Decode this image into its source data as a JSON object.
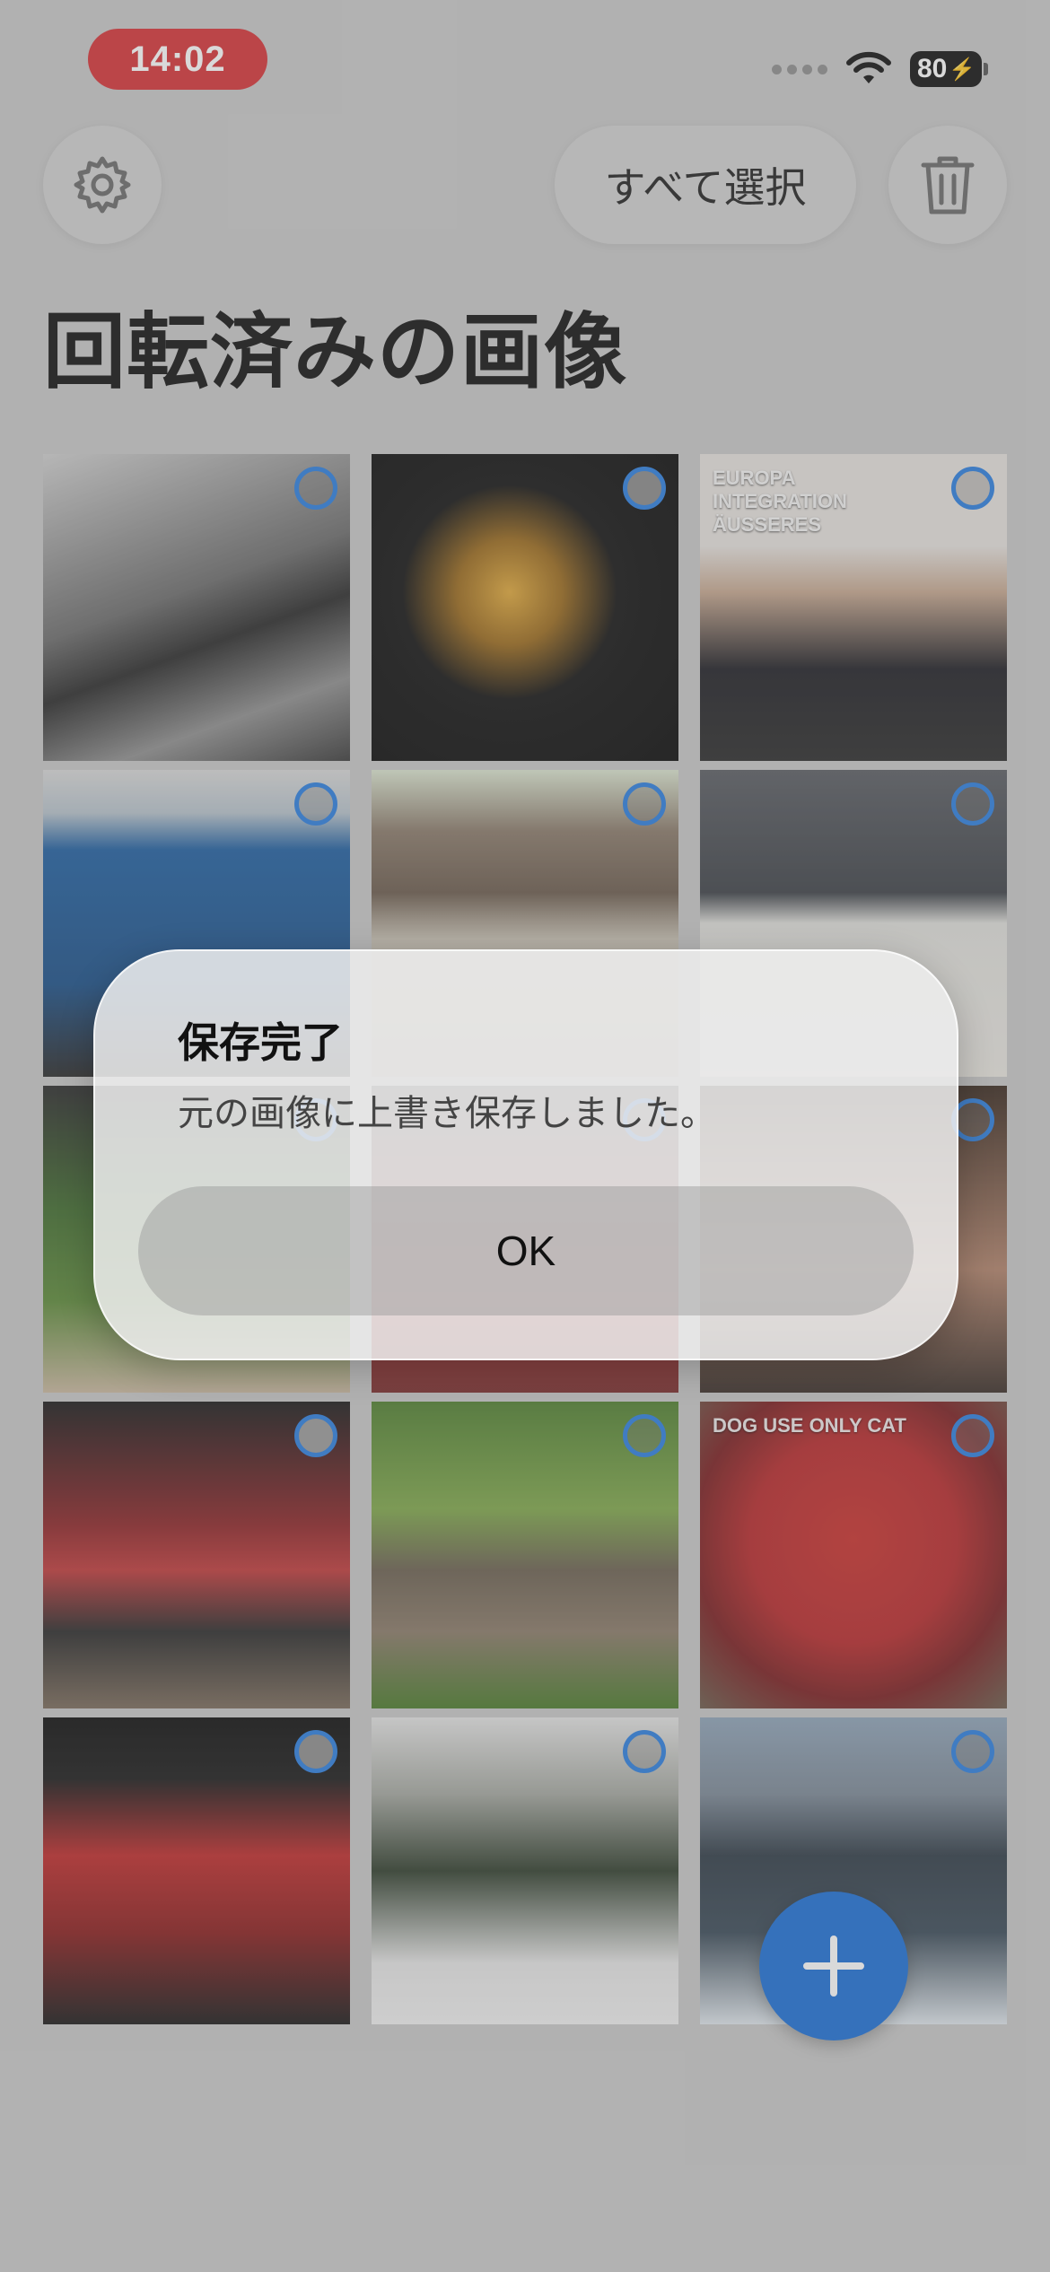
{
  "status_bar": {
    "time": "14:02",
    "battery": "80"
  },
  "toolbar": {
    "select_all_label": "すべて選択"
  },
  "page": {
    "title": "回転済みの画像"
  },
  "photos": [
    {
      "label": "",
      "bg": "linear-gradient(160deg,#cfcfcf 0%,#6c6c6c 45%,#2a2a2a 60%,#8f8f8f 80%,#3b3b3b 100%)",
      "check_fill": ""
    },
    {
      "label": "",
      "bg": "radial-gradient(ellipse at 45% 45%,#e0a83a 0%,#9b6a1c 22%,#121212 45%,#0a0a0a 100%)",
      "check_fill": "#8a8a8a"
    },
    {
      "label": "EUROPA INTEGRATION ÄUSSERES",
      "bg": "linear-gradient(180deg,#e6e2de 0%,#e6e2de 30%,#c6a78f 45%,#1e1e24 70%,#2a2a2a 100%)",
      "check_fill": ""
    },
    {
      "label": "",
      "bg": "linear-gradient(180deg,#d8d8d8 0%,#b7c3cc 14%,#1f5fa1 26%,#1a4f88 70%,#2a2a2a 100%)",
      "check_fill": ""
    },
    {
      "label": "",
      "bg": "linear-gradient(180deg,#dbe5d0 0%,#8a7a6a 20%,#6b5b4d 40%,#c9c2b4 55%,#bdb6a8 100%)",
      "check_fill": ""
    },
    {
      "label": "",
      "bg": "linear-gradient(180deg,#5a5d63 0%,#3d4147 40%,#e0e0dc 50%,#e9e6e0 100%)",
      "check_fill": ""
    },
    {
      "label": "",
      "bg": "linear-gradient(180deg,#2b2b2b 0%,#3f6b2d 40%,#5c8a38 70%,#c9b79e 100%)",
      "check_fill": ""
    },
    {
      "label": "",
      "bg": "linear-gradient(180deg,#4d4d4d 0%,#a33 70%,#7a2a2a 100%)",
      "check_fill": ""
    },
    {
      "label": "",
      "bg": "linear-gradient(180deg,#3a2a20 0%,#b1826a 60%,#3a2e28 100%)",
      "check_fill": ""
    },
    {
      "label": "",
      "bg": "linear-gradient(180deg,#1b1b1b 0%,#8d2427 40%,#c0393a 55%,#2a2a2a 75%,#7a6a5a 100%)",
      "check_fill": "#9a9a9a"
    },
    {
      "label": "",
      "bg": "linear-gradient(180deg,#4f7f2f 0%,#7fa84a 35%,#6b6050 55%,#8a7a68 75%,#4a7a2a 100%)",
      "check_fill": ""
    },
    {
      "label": "DOG USE ONLY CAT",
      "bg": "radial-gradient(circle at 50% 45%,#c9302c 0%,#b8282a 45%,#7a1d1f 70%,#6a5a4a 100%)",
      "check_fill": ""
    },
    {
      "label": "",
      "bg": "linear-gradient(180deg,#0d0d0d 0%,#1a1a1a 20%,#c02a2a 45%,#8a1d1d 70%,#1a1a1a 100%)",
      "check_fill": "#8e8e8e"
    },
    {
      "label": "",
      "bg": "linear-gradient(180deg,#e4e4e4 0%,#a4a7a0 25%,#2f3d2c 50%,#e6e6e6 80%,#f0f0f0 100%)",
      "check_fill": ""
    },
    {
      "label": "",
      "bg": "linear-gradient(180deg,#8ea3b8 0%,#7b8896 25%,#2f3b46 45%,#3a4a58 70%,#dfe6ec 100%)",
      "check_fill": ""
    }
  ],
  "alert": {
    "title": "保存完了",
    "message": "元の画像に上書き保存しました。",
    "ok_label": "OK"
  }
}
